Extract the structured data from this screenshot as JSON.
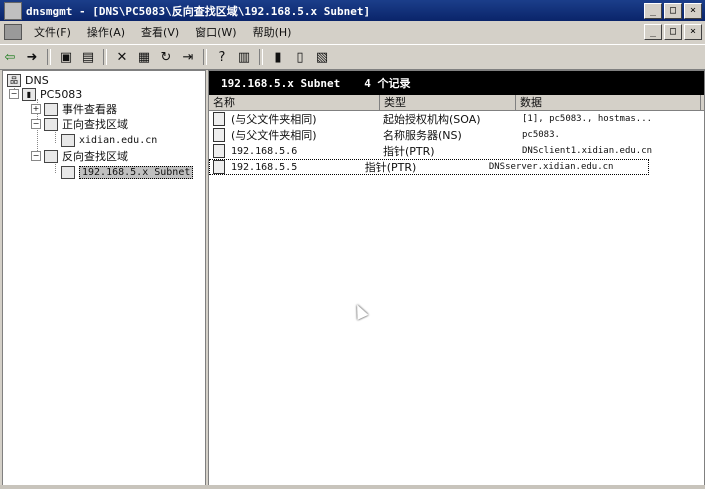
{
  "window": {
    "title": "dnsmgmt - [DNS\\PC5083\\反向查找区域\\192.168.5.x Subnet]",
    "controls": [
      "_",
      "□",
      "×"
    ],
    "mdi_controls": [
      "_",
      "□",
      "×"
    ]
  },
  "menu": [
    "文件(F)",
    "操作(A)",
    "查看(V)",
    "窗口(W)",
    "帮助(H)"
  ],
  "toolbar": [
    "back-icon",
    "forward-icon",
    "up-icon",
    "show-tree-icon",
    "delete-icon",
    "properties-icon",
    "refresh-icon",
    "export-icon",
    "help-icon",
    "view-icon",
    "new-record-icon",
    "new-record2-icon",
    "new-record3-icon"
  ],
  "tree": {
    "root": "DNS",
    "server": "PC5083",
    "items": [
      "事件查看器",
      "正向查找区域",
      "xidian.edu.cn",
      "反向查找区域",
      "192.168.5.x Subnet"
    ]
  },
  "right": {
    "zone_label": "192.168.5.x Subnet",
    "count_label": "4 个记录",
    "columns": [
      "名称",
      "类型",
      "数据"
    ],
    "rows": [
      {
        "name": "(与父文件夹相同)",
        "type": "起始授权机构(SOA)",
        "data": "[1], pc5083., hostmas..."
      },
      {
        "name": "(与父文件夹相同)",
        "type": "名称服务器(NS)",
        "data": "pc5083."
      },
      {
        "name": "192.168.5.6",
        "type": "指针(PTR)",
        "data": "DNSclient1.xidian.edu.cn"
      },
      {
        "name": "192.168.5.5",
        "type": "指针(PTR)",
        "data": "DNSserver.xidian.edu.cn"
      }
    ]
  }
}
